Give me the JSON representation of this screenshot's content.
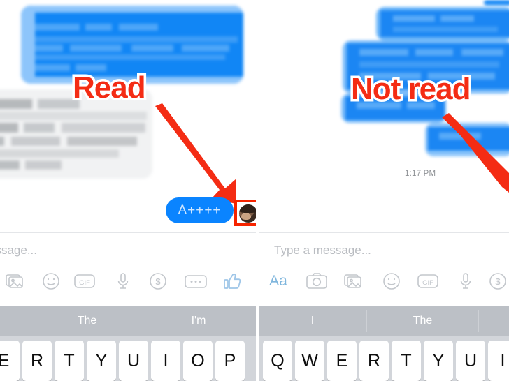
{
  "meta": {
    "accent_red": "#f42c14",
    "messenger_blue": "#0a84ff",
    "bubble_blue": "#1b8cf7",
    "bubble_grey": "#e9eaec",
    "keyboard_bg": "#d2d5da",
    "suggestion_bg": "#bcc0c6",
    "placeholder_color": "#b9bcc1"
  },
  "left_panel": {
    "annotation": {
      "label": "Read"
    },
    "sent_bubble": {
      "text": "A++++"
    },
    "avatar": {
      "name": "profile-photo",
      "highlighted": true
    },
    "composer": {
      "placeholder": "Type a message...",
      "placeholder_visible": "essage...",
      "icons": [
        {
          "name": "photo-gallery-icon",
          "label": ""
        },
        {
          "name": "smiley-icon",
          "label": ""
        },
        {
          "name": "gif-icon",
          "label": "GIF"
        },
        {
          "name": "microphone-icon",
          "label": ""
        },
        {
          "name": "dollar-icon",
          "label": "$"
        },
        {
          "name": "more-options-icon",
          "label": ""
        },
        {
          "name": "thumbs-up-icon",
          "label": ""
        }
      ]
    },
    "keyboard": {
      "suggestions": [
        "",
        "The",
        "I'm"
      ],
      "keys": [
        "E",
        "R",
        "T",
        "Y",
        "U",
        "I",
        "O",
        "P"
      ]
    }
  },
  "right_panel": {
    "annotation": {
      "label": "Not read"
    },
    "timestamp": "1:17 PM",
    "composer": {
      "placeholder": "Type a message...",
      "icons": [
        {
          "name": "text-format-icon",
          "label": "Aa"
        },
        {
          "name": "camera-icon",
          "label": ""
        },
        {
          "name": "photo-gallery-icon",
          "label": ""
        },
        {
          "name": "smiley-icon",
          "label": ""
        },
        {
          "name": "gif-icon",
          "label": "GIF"
        },
        {
          "name": "microphone-icon",
          "label": ""
        },
        {
          "name": "dollar-icon",
          "label": "$"
        }
      ]
    },
    "keyboard": {
      "suggestions": [
        "I",
        "The",
        ""
      ],
      "keys": [
        "Q",
        "W",
        "E",
        "R",
        "T",
        "Y",
        "U",
        "I"
      ]
    }
  }
}
